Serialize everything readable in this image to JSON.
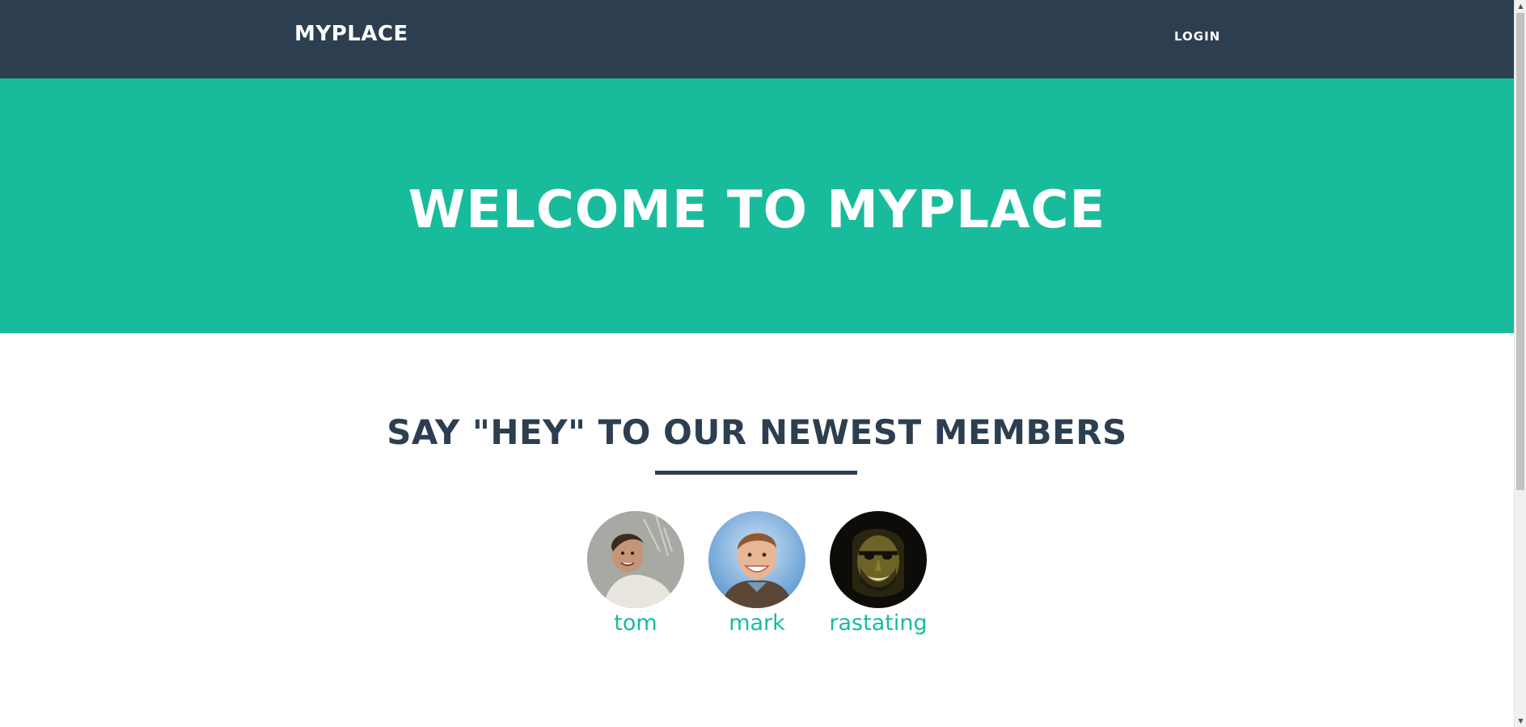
{
  "nav": {
    "brand": "MYPLACE",
    "login_label": "LOGIN"
  },
  "hero": {
    "title": "WELCOME TO MYPLACE"
  },
  "members_section": {
    "title": "SAY \"HEY\" TO OUR NEWEST MEMBERS",
    "members": [
      {
        "name": "tom"
      },
      {
        "name": "mark"
      },
      {
        "name": "rastating"
      }
    ]
  },
  "scrollbar": {
    "up_glyph": "▲",
    "down_glyph": "▼"
  },
  "colors": {
    "navbar": "#2c3e50",
    "accent": "#18bc9c",
    "heading": "#2c3e50",
    "text_light": "#ffffff"
  }
}
